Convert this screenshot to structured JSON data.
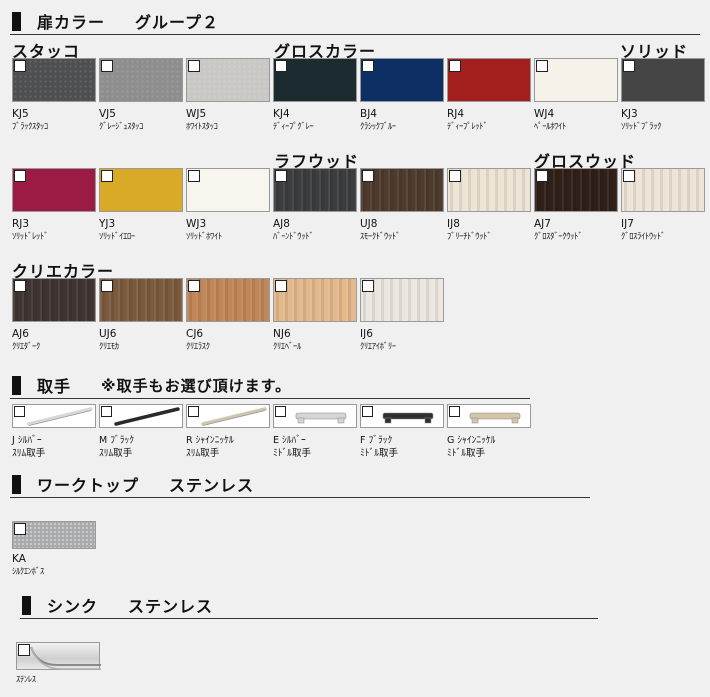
{
  "sections": {
    "door": {
      "label": "扉カラー",
      "sub": "グループ２"
    },
    "handle": {
      "label": "取手",
      "sub": "※取手もお選び頂けます。"
    },
    "worktop": {
      "label": "ワークトップ",
      "sub": "ステンレス"
    },
    "sink": {
      "label": "シンク",
      "sub": "ステンレス"
    }
  },
  "groups": {
    "stucco": "スタッコ",
    "gloss": "グロスカラー",
    "solid": "ソリッド",
    "rough_wood": "ラフウッド",
    "gloss_wood": "グロスウッド",
    "crie": "クリエカラー"
  },
  "swatches": [
    {
      "code": "KJ5",
      "name": "ﾌﾞﾗｯｸｽﾀｯｺ",
      "color": "#4e4f51",
      "texture": "stucco"
    },
    {
      "code": "VJ5",
      "name": "ｸﾞﾚｰｼﾞｭｽﾀｯｺ",
      "color": "#8e8e8e",
      "texture": "stucco"
    },
    {
      "code": "WJ5",
      "name": "ﾎﾜｲﾄｽﾀｯｺ",
      "color": "#c9c8c4",
      "texture": "stucco"
    },
    {
      "code": "KJ4",
      "name": "ﾃﾞｨｰﾌﾟｸﾞﾚｰ",
      "color": "#1b2b30",
      "texture": "none"
    },
    {
      "code": "BJ4",
      "name": "ｸﾗｼｯｸﾌﾞﾙｰ",
      "color": "#0e2f63",
      "texture": "none"
    },
    {
      "code": "RJ4",
      "name": "ﾃﾞｨｰﾌﾟﾚｯﾄﾞ",
      "color": "#a3201f",
      "texture": "none"
    },
    {
      "code": "WJ4",
      "name": "ﾍﾟｰﾙﾎﾜｲﾄ",
      "color": "#f6f2ea",
      "texture": "none"
    },
    {
      "code": "KJ3",
      "name": "ｿﾘｯﾄﾞﾌﾞﾗｯｸ",
      "color": "#454545",
      "texture": "none"
    },
    {
      "code": "RJ3",
      "name": "ｿﾘｯﾄﾞﾚｯﾄﾞ",
      "color": "#9c1b45",
      "texture": "none"
    },
    {
      "code": "YJ3",
      "name": "ｿﾘｯﾄﾞｲｴﾛｰ",
      "color": "#d9aa28",
      "texture": "none"
    },
    {
      "code": "WJ3",
      "name": "ｿﾘｯﾄﾞﾎﾜｲﾄ",
      "color": "#f8f5ee",
      "texture": "none"
    },
    {
      "code": "AJ8",
      "name": "ﾊﾞｰﾝﾄﾞｳｯﾄﾞ",
      "color": "#3c3d3f",
      "texture": "wood"
    },
    {
      "code": "UJ8",
      "name": "ｽﾓｰｸﾄﾞｳｯﾄﾞ",
      "color": "#4f3a2e",
      "texture": "wood"
    },
    {
      "code": "IJ8",
      "name": "ﾌﾞﾘｰﾁﾄﾞｳｯﾄﾞ",
      "color": "#ece4d4",
      "texture": "wood"
    },
    {
      "code": "AJ7",
      "name": "ｸﾞﾛｽﾀﾞｰｸｳｯﾄﾞ",
      "color": "#2f2019",
      "texture": "wood"
    },
    {
      "code": "IJ7",
      "name": "ｸﾞﾛｽﾗｲﾄｳｯﾄﾞ",
      "color": "#ece4d6",
      "texture": "wood"
    },
    {
      "code": "AJ6",
      "name": "ｸﾘｴﾀﾞｰｸ",
      "color": "#3e3532",
      "texture": "wood"
    },
    {
      "code": "UJ6",
      "name": "ｸﾘｴﾓｶ",
      "color": "#7b5a3e",
      "texture": "wood"
    },
    {
      "code": "CJ6",
      "name": "ｸﾘｴﾗｽｸ",
      "color": "#c08659",
      "texture": "wood"
    },
    {
      "code": "NJ6",
      "name": "ｸﾘｴﾍﾞｰﾙ",
      "color": "#e3b98c",
      "texture": "wood"
    },
    {
      "code": "IJ6",
      "name": "ｸﾘｴｱｲﾎﾞﾘｰ",
      "color": "#ebe7e0",
      "texture": "wood"
    }
  ],
  "handles": [
    {
      "line1": "J ｼﾙﾊﾞｰ",
      "line2": "ｽﾘﾑ取手",
      "color": "#d8d8d8",
      "style": "slim"
    },
    {
      "line1": "M ﾌﾞﾗｯｸ",
      "line2": "ｽﾘﾑ取手",
      "color": "#2a2a2a",
      "style": "slim"
    },
    {
      "line1": "R ｼｬｲﾝﾆｯｹﾙ",
      "line2": "ｽﾘﾑ取手",
      "color": "#cfc6b0",
      "style": "slim"
    },
    {
      "line1": "E ｼﾙﾊﾞｰ",
      "line2": "ﾐﾄﾞﾙ取手",
      "color": "#d4d4d4",
      "style": "middle"
    },
    {
      "line1": "F ﾌﾞﾗｯｸ",
      "line2": "ﾐﾄﾞﾙ取手",
      "color": "#2f2f2f",
      "style": "middle"
    },
    {
      "line1": "G ｼｬｲﾝﾆｯｹﾙ",
      "line2": "ﾐﾄﾞﾙ取手",
      "color": "#d1c6aa",
      "style": "middle"
    }
  ],
  "worktop": {
    "code": "KA",
    "name": "ｼﾙｸｴﾝﾎﾞｽ",
    "color": "#a9aaac"
  },
  "sink": {
    "name": "ｽﾃﾝﾚｽ",
    "color": "#d8d8d8"
  }
}
